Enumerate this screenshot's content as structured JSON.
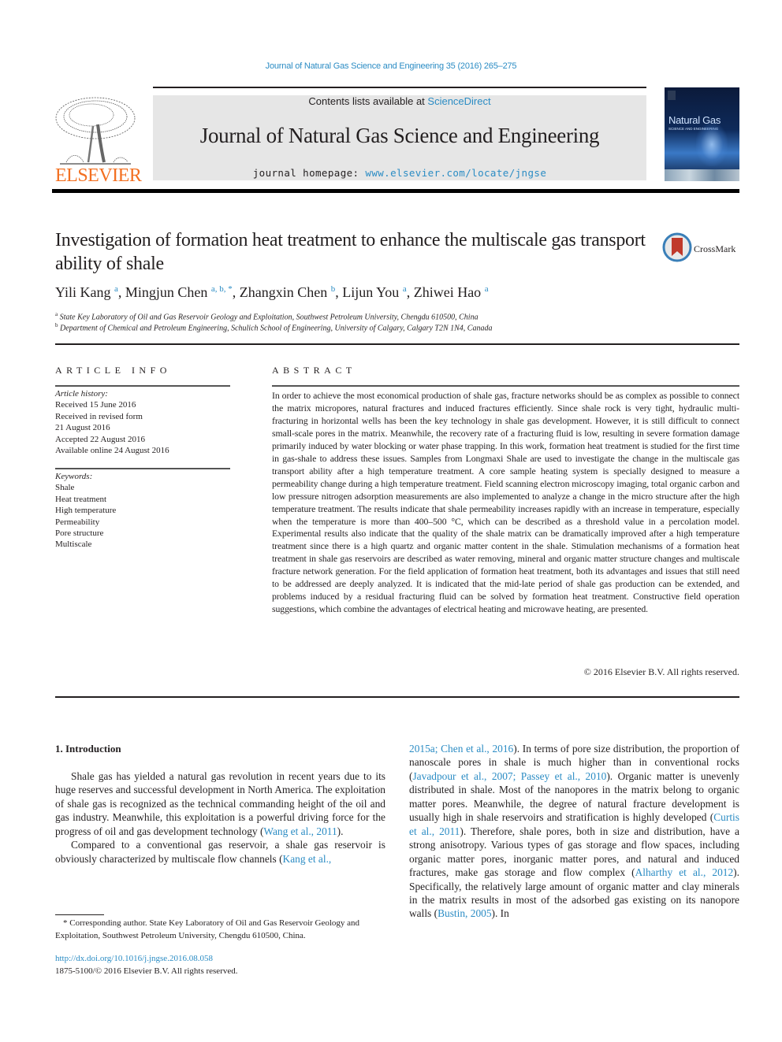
{
  "header": {
    "citation": "Journal of Natural Gas Science and Engineering 35 (2016) 265–275",
    "contents_prefix": "Contents lists available at ",
    "contents_link": "ScienceDirect",
    "journal_name": "Journal of Natural Gas Science and Engineering",
    "homepage_prefix": "journal homepage: ",
    "homepage_link": "www.elsevier.com/locate/jngse",
    "publisher_logo_text": "ELSEVIER",
    "cover": {
      "line1": "Natural Gas",
      "line2": "SCIENCE AND ENGINEERING"
    }
  },
  "article": {
    "title": "Investigation of formation heat treatment to enhance the multiscale gas transport ability of shale",
    "crossmark_label": "CrossMark",
    "authors": [
      {
        "name": "Yili Kang",
        "sup": "a"
      },
      {
        "name": "Mingjun Chen",
        "sup": "a, b, *"
      },
      {
        "name": "Zhangxin Chen",
        "sup": "b"
      },
      {
        "name": "Lijun You",
        "sup": "a"
      },
      {
        "name": "Zhiwei Hao",
        "sup": "a"
      }
    ],
    "affiliations": [
      {
        "sup": "a",
        "text": "State Key Laboratory of Oil and Gas Reservoir Geology and Exploitation, Southwest Petroleum University, Chengdu 610500, China"
      },
      {
        "sup": "b",
        "text": "Department of Chemical and Petroleum Engineering, Schulich School of Engineering, University of Calgary, Calgary T2N 1N4, Canada"
      }
    ]
  },
  "article_info": {
    "heading": "ARTICLE INFO",
    "history_label": "Article history:",
    "history": [
      "Received 15 June 2016",
      "Received in revised form",
      "21 August 2016",
      "Accepted 22 August 2016",
      "Available online 24 August 2016"
    ],
    "keywords_label": "Keywords:",
    "keywords": [
      "Shale",
      "Heat treatment",
      "High temperature",
      "Permeability",
      "Pore structure",
      "Multiscale"
    ]
  },
  "abstract": {
    "heading": "ABSTRACT",
    "text": "In order to achieve the most economical production of shale gas, fracture networks should be as complex as possible to connect the matrix micropores, natural fractures and induced fractures efficiently. Since shale rock is very tight, hydraulic multi-fracturing in horizontal wells has been the key technology in shale gas development. However, it is still difficult to connect small-scale pores in the matrix. Meanwhile, the recovery rate of a fracturing fluid is low, resulting in severe formation damage primarily induced by water blocking or water phase trapping. In this work, formation heat treatment is studied for the first time in gas-shale to address these issues. Samples from Longmaxi Shale are used to investigate the change in the multiscale gas transport ability after a high temperature treatment. A core sample heating system is specially designed to measure a permeability change during a high temperature treatment. Field scanning electron microscopy imaging, total organic carbon and low pressure nitrogen adsorption measurements are also implemented to analyze a change in the micro structure after the high temperature treatment. The results indicate that shale permeability increases rapidly with an increase in temperature, especially when the temperature is more than 400–500 °C, which can be described as a threshold value in a percolation model. Experimental results also indicate that the quality of the shale matrix can be dramatically improved after a high temperature treatment since there is a high quartz and organic matter content in the shale. Stimulation mechanisms of a formation heat treatment in shale gas reservoirs are described as water removing, mineral and organic matter structure changes and multiscale fracture network generation. For the field application of formation heat treatment, both its advantages and issues that still need to be addressed are deeply analyzed. It is indicated that the mid-late period of shale gas production can be extended, and problems induced by a residual fracturing fluid can be solved by formation heat treatment. Constructive field operation suggestions, which combine the advantages of electrical heating and microwave heating, are presented.",
    "copyright": "© 2016 Elsevier B.V. All rights reserved."
  },
  "introduction": {
    "heading": "1.  Introduction",
    "left": {
      "p1_a": "Shale gas has yielded a natural gas revolution in recent years due to its huge reserves and successful development in North America. The exploitation of shale gas is recognized as the technical commanding height of the oil and gas industry. Meanwhile, this exploitation is a powerful driving force for the progress of oil and gas development technology (",
      "p1_ref": "Wang et al., 2011",
      "p1_b": ").",
      "p2_a": "Compared to a conventional gas reservoir, a shale gas reservoir is obviously characterized by multiscale flow channels (",
      "p2_ref": "Kang et al.,"
    },
    "right": {
      "ref1": "2015a; Chen et al., 2016",
      "t1": "). In terms of pore size distribution, the proportion of nanoscale pores in shale is much higher than in conventional rocks (",
      "ref2": "Javadpour et al., 2007; Passey et al., 2010",
      "t2": "). Organic matter is unevenly distributed in shale. Most of the nanopores in the matrix belong to organic matter pores. Meanwhile, the degree of natural fracture development is usually high in shale reservoirs and stratification is highly developed (",
      "ref3": "Curtis et al., 2011",
      "t3": "). Therefore, shale pores, both in size and distribution, have a strong anisotropy. Various types of gas storage and flow spaces, including organic matter pores, inorganic matter pores, and natural and induced fractures, make gas storage and flow complex (",
      "ref4": "Alharthy et al., 2012",
      "t4": "). Specifically, the relatively large amount of organic matter and clay minerals in the matrix results in most of the adsorbed gas existing on its nanopore walls (",
      "ref5": "Bustin, 2005",
      "t5": "). In"
    }
  },
  "footnote": {
    "text": "* Corresponding author. State Key Laboratory of Oil and Gas Reservoir Geology and Exploitation, Southwest Petroleum University, Chengdu 610500, China.",
    "doi": "http://dx.doi.org/10.1016/j.jngse.2016.08.058",
    "issn": "1875-5100/© 2016 Elsevier B.V. All rights reserved."
  },
  "colors": {
    "link": "#2b8cc4",
    "elsevier_orange": "#f37021",
    "banner_bg": "#e6e6e6"
  }
}
